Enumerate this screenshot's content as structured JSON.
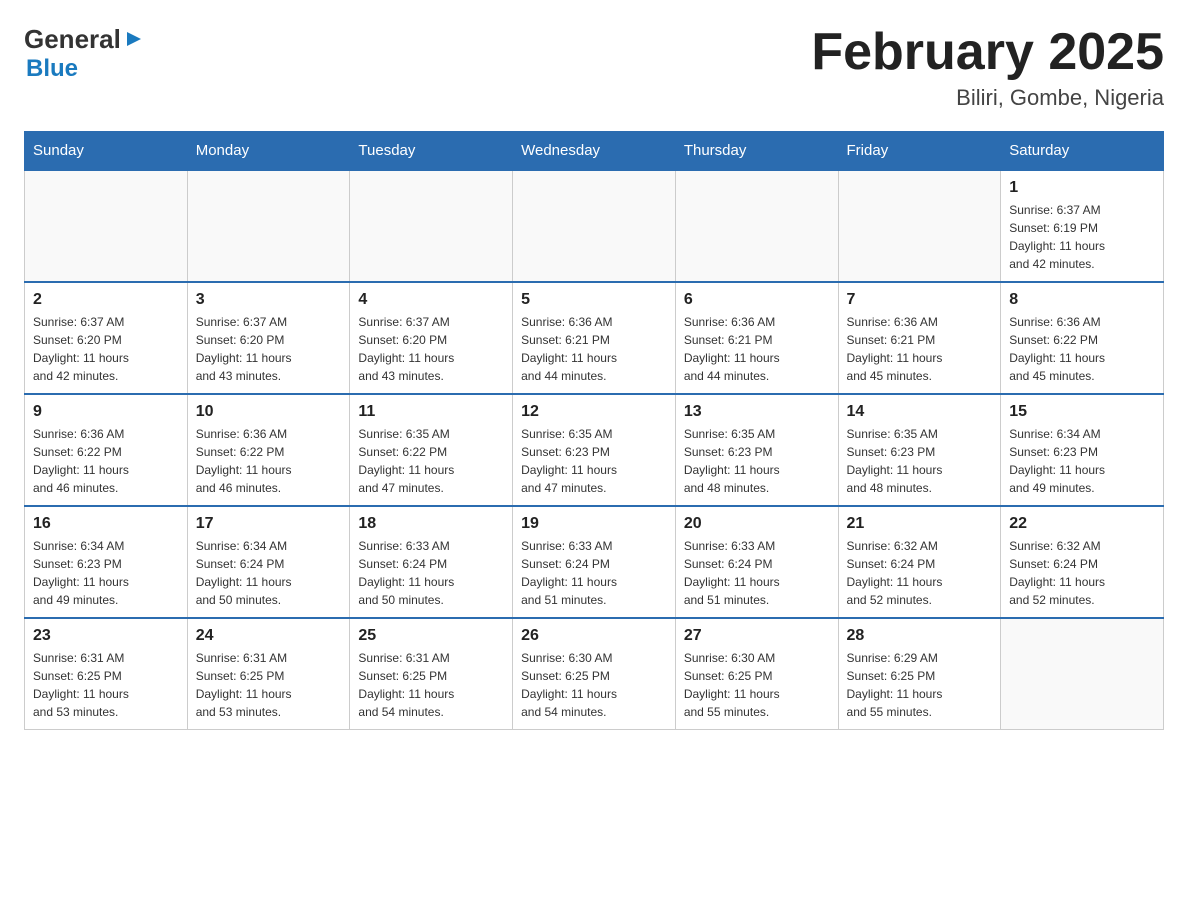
{
  "logo": {
    "general": "General",
    "blue": "Blue",
    "arrow": "▶"
  },
  "title": "February 2025",
  "subtitle": "Biliri, Gombe, Nigeria",
  "weekdays": [
    "Sunday",
    "Monday",
    "Tuesday",
    "Wednesday",
    "Thursday",
    "Friday",
    "Saturday"
  ],
  "weeks": [
    [
      {
        "day": "",
        "info": ""
      },
      {
        "day": "",
        "info": ""
      },
      {
        "day": "",
        "info": ""
      },
      {
        "day": "",
        "info": ""
      },
      {
        "day": "",
        "info": ""
      },
      {
        "day": "",
        "info": ""
      },
      {
        "day": "1",
        "info": "Sunrise: 6:37 AM\nSunset: 6:19 PM\nDaylight: 11 hours\nand 42 minutes."
      }
    ],
    [
      {
        "day": "2",
        "info": "Sunrise: 6:37 AM\nSunset: 6:20 PM\nDaylight: 11 hours\nand 42 minutes."
      },
      {
        "day": "3",
        "info": "Sunrise: 6:37 AM\nSunset: 6:20 PM\nDaylight: 11 hours\nand 43 minutes."
      },
      {
        "day": "4",
        "info": "Sunrise: 6:37 AM\nSunset: 6:20 PM\nDaylight: 11 hours\nand 43 minutes."
      },
      {
        "day": "5",
        "info": "Sunrise: 6:36 AM\nSunset: 6:21 PM\nDaylight: 11 hours\nand 44 minutes."
      },
      {
        "day": "6",
        "info": "Sunrise: 6:36 AM\nSunset: 6:21 PM\nDaylight: 11 hours\nand 44 minutes."
      },
      {
        "day": "7",
        "info": "Sunrise: 6:36 AM\nSunset: 6:21 PM\nDaylight: 11 hours\nand 45 minutes."
      },
      {
        "day": "8",
        "info": "Sunrise: 6:36 AM\nSunset: 6:22 PM\nDaylight: 11 hours\nand 45 minutes."
      }
    ],
    [
      {
        "day": "9",
        "info": "Sunrise: 6:36 AM\nSunset: 6:22 PM\nDaylight: 11 hours\nand 46 minutes."
      },
      {
        "day": "10",
        "info": "Sunrise: 6:36 AM\nSunset: 6:22 PM\nDaylight: 11 hours\nand 46 minutes."
      },
      {
        "day": "11",
        "info": "Sunrise: 6:35 AM\nSunset: 6:22 PM\nDaylight: 11 hours\nand 47 minutes."
      },
      {
        "day": "12",
        "info": "Sunrise: 6:35 AM\nSunset: 6:23 PM\nDaylight: 11 hours\nand 47 minutes."
      },
      {
        "day": "13",
        "info": "Sunrise: 6:35 AM\nSunset: 6:23 PM\nDaylight: 11 hours\nand 48 minutes."
      },
      {
        "day": "14",
        "info": "Sunrise: 6:35 AM\nSunset: 6:23 PM\nDaylight: 11 hours\nand 48 minutes."
      },
      {
        "day": "15",
        "info": "Sunrise: 6:34 AM\nSunset: 6:23 PM\nDaylight: 11 hours\nand 49 minutes."
      }
    ],
    [
      {
        "day": "16",
        "info": "Sunrise: 6:34 AM\nSunset: 6:23 PM\nDaylight: 11 hours\nand 49 minutes."
      },
      {
        "day": "17",
        "info": "Sunrise: 6:34 AM\nSunset: 6:24 PM\nDaylight: 11 hours\nand 50 minutes."
      },
      {
        "day": "18",
        "info": "Sunrise: 6:33 AM\nSunset: 6:24 PM\nDaylight: 11 hours\nand 50 minutes."
      },
      {
        "day": "19",
        "info": "Sunrise: 6:33 AM\nSunset: 6:24 PM\nDaylight: 11 hours\nand 51 minutes."
      },
      {
        "day": "20",
        "info": "Sunrise: 6:33 AM\nSunset: 6:24 PM\nDaylight: 11 hours\nand 51 minutes."
      },
      {
        "day": "21",
        "info": "Sunrise: 6:32 AM\nSunset: 6:24 PM\nDaylight: 11 hours\nand 52 minutes."
      },
      {
        "day": "22",
        "info": "Sunrise: 6:32 AM\nSunset: 6:24 PM\nDaylight: 11 hours\nand 52 minutes."
      }
    ],
    [
      {
        "day": "23",
        "info": "Sunrise: 6:31 AM\nSunset: 6:25 PM\nDaylight: 11 hours\nand 53 minutes."
      },
      {
        "day": "24",
        "info": "Sunrise: 6:31 AM\nSunset: 6:25 PM\nDaylight: 11 hours\nand 53 minutes."
      },
      {
        "day": "25",
        "info": "Sunrise: 6:31 AM\nSunset: 6:25 PM\nDaylight: 11 hours\nand 54 minutes."
      },
      {
        "day": "26",
        "info": "Sunrise: 6:30 AM\nSunset: 6:25 PM\nDaylight: 11 hours\nand 54 minutes."
      },
      {
        "day": "27",
        "info": "Sunrise: 6:30 AM\nSunset: 6:25 PM\nDaylight: 11 hours\nand 55 minutes."
      },
      {
        "day": "28",
        "info": "Sunrise: 6:29 AM\nSunset: 6:25 PM\nDaylight: 11 hours\nand 55 minutes."
      },
      {
        "day": "",
        "info": ""
      }
    ]
  ]
}
